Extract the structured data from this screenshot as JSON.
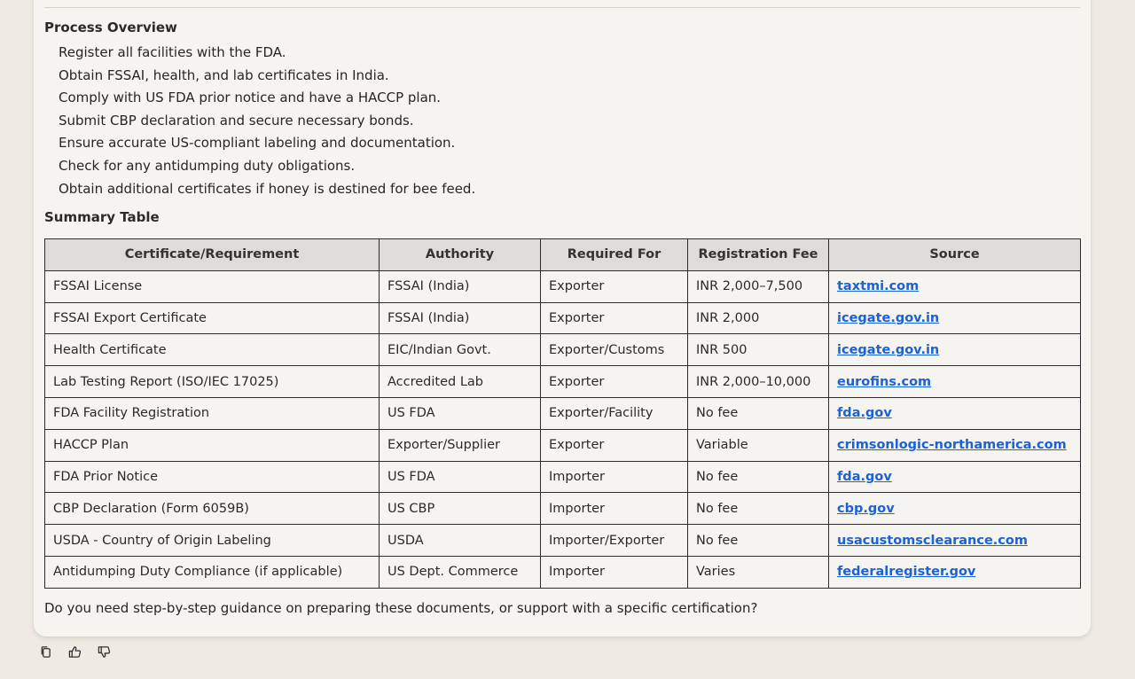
{
  "process": {
    "title": "Process Overview",
    "steps": [
      "Register all facilities with the FDA.",
      "Obtain FSSAI, health, and lab certificates in India.",
      "Comply with US FDA prior notice and have a HACCP plan.",
      "Submit CBP declaration and secure necessary bonds.",
      "Ensure accurate US-compliant labeling and documentation.",
      "Check for any antidumping duty obligations.",
      "Obtain additional certificates if honey is destined for bee feed."
    ]
  },
  "summary": {
    "title": "Summary Table",
    "headers": [
      "Certificate/Requirement",
      "Authority",
      "Required For",
      "Registration Fee",
      "Source"
    ],
    "rows": [
      [
        "FSSAI License",
        "FSSAI (India)",
        "Exporter",
        "INR 2,000–7,500",
        "taxtmi.com"
      ],
      [
        "FSSAI Export Certificate",
        "FSSAI (India)",
        "Exporter",
        "INR 2,000",
        "icegate.gov.in"
      ],
      [
        "Health Certificate",
        "EIC/Indian Govt.",
        "Exporter/Customs",
        "INR 500",
        "icegate.gov.in"
      ],
      [
        "Lab Testing Report (ISO/IEC 17025)",
        "Accredited Lab",
        "Exporter",
        "INR 2,000–10,000",
        "eurofins.com"
      ],
      [
        "FDA Facility Registration",
        "US FDA",
        "Exporter/Facility",
        "No fee",
        "fda.gov"
      ],
      [
        "HACCP Plan",
        "Exporter/Supplier",
        "Exporter",
        "Variable",
        "crimsonlogic-northamerica.com"
      ],
      [
        "FDA Prior Notice",
        "US FDA",
        "Importer",
        "No fee",
        "fda.gov"
      ],
      [
        "CBP Declaration (Form 6059B)",
        "US CBP",
        "Importer",
        "No fee",
        "cbp.gov"
      ],
      [
        "USDA - Country of Origin Labeling",
        "USDA",
        "Importer/Exporter",
        "No fee",
        "usacustomsclearance.com"
      ],
      [
        "Antidumping Duty Compliance (if applicable)",
        "US Dept. Commerce",
        "Importer",
        "Varies",
        "federalregister.gov"
      ]
    ]
  },
  "footer": {
    "question": "Do you need step-by-step guidance on preparing these documents, or support with a specific certification?"
  },
  "actions": {
    "icons": [
      "copy-icon",
      "thumbs-up-icon",
      "thumbs-down-icon"
    ]
  },
  "colors": {
    "link": "#1a62d6",
    "header_bg": "#dedcd8",
    "page_bg": "#efebe4"
  }
}
